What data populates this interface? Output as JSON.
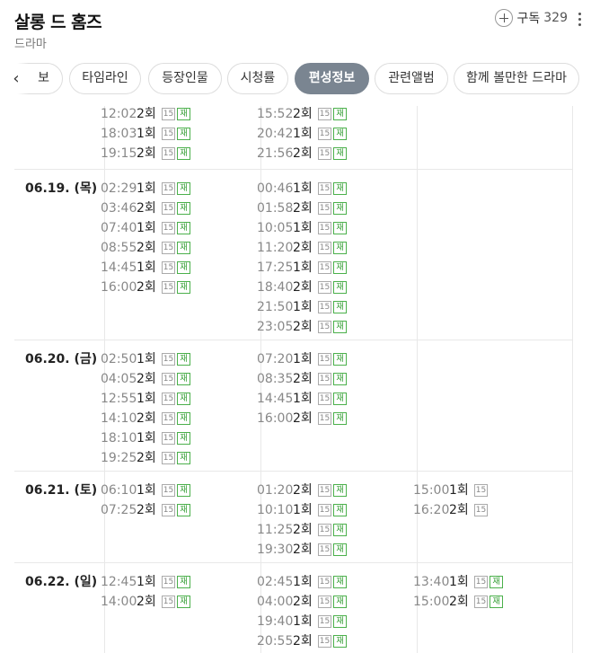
{
  "header": {
    "title": "살롱 드 홈즈",
    "genre": "드라마",
    "subscribe_label": "구독",
    "subscribe_count": "329"
  },
  "tabs": [
    {
      "label": "정보",
      "visible_label": "보"
    },
    {
      "label": "타임라인"
    },
    {
      "label": "등장인물"
    },
    {
      "label": "시청률"
    },
    {
      "label": "편성정보",
      "active": true
    },
    {
      "label": "관련앨범"
    },
    {
      "label": "함께 볼만한 드라마"
    }
  ],
  "badges": {
    "age": "15",
    "rerun": "재"
  },
  "schedule": [
    {
      "date": "",
      "columns": [
        [
          {
            "time": "12:02",
            "ep": "2회",
            "re": true
          },
          {
            "time": "18:03",
            "ep": "1회",
            "re": true
          },
          {
            "time": "19:15",
            "ep": "2회",
            "re": true
          }
        ],
        [
          {
            "time": "15:52",
            "ep": "2회",
            "re": true
          },
          {
            "time": "20:42",
            "ep": "1회",
            "re": true
          },
          {
            "time": "21:56",
            "ep": "2회",
            "re": true
          }
        ],
        []
      ]
    },
    {
      "date": "06.19. (목)",
      "columns": [
        [
          {
            "time": "02:29",
            "ep": "1회",
            "re": true
          },
          {
            "time": "03:46",
            "ep": "2회",
            "re": true
          },
          {
            "time": "07:40",
            "ep": "1회",
            "re": true
          },
          {
            "time": "08:55",
            "ep": "2회",
            "re": true
          },
          {
            "time": "14:45",
            "ep": "1회",
            "re": true
          },
          {
            "time": "16:00",
            "ep": "2회",
            "re": true
          }
        ],
        [
          {
            "time": "00:46",
            "ep": "1회",
            "re": true
          },
          {
            "time": "01:58",
            "ep": "2회",
            "re": true
          },
          {
            "time": "10:05",
            "ep": "1회",
            "re": true
          },
          {
            "time": "11:20",
            "ep": "2회",
            "re": true
          },
          {
            "time": "17:25",
            "ep": "1회",
            "re": true
          },
          {
            "time": "18:40",
            "ep": "2회",
            "re": true
          },
          {
            "time": "21:50",
            "ep": "1회",
            "re": true
          },
          {
            "time": "23:05",
            "ep": "2회",
            "re": true
          }
        ],
        []
      ]
    },
    {
      "date": "06.20. (금)",
      "columns": [
        [
          {
            "time": "02:50",
            "ep": "1회",
            "re": true
          },
          {
            "time": "04:05",
            "ep": "2회",
            "re": true
          },
          {
            "time": "12:55",
            "ep": "1회",
            "re": true
          },
          {
            "time": "14:10",
            "ep": "2회",
            "re": true
          },
          {
            "time": "18:10",
            "ep": "1회",
            "re": true
          },
          {
            "time": "19:25",
            "ep": "2회",
            "re": true
          }
        ],
        [
          {
            "time": "07:20",
            "ep": "1회",
            "re": true
          },
          {
            "time": "08:35",
            "ep": "2회",
            "re": true
          },
          {
            "time": "14:45",
            "ep": "1회",
            "re": true
          },
          {
            "time": "16:00",
            "ep": "2회",
            "re": true
          }
        ],
        []
      ]
    },
    {
      "date": "06.21. (토)",
      "columns": [
        [
          {
            "time": "06:10",
            "ep": "1회",
            "re": true
          },
          {
            "time": "07:25",
            "ep": "2회",
            "re": true
          }
        ],
        [
          {
            "time": "01:20",
            "ep": "2회",
            "re": true
          },
          {
            "time": "10:10",
            "ep": "1회",
            "re": true
          },
          {
            "time": "11:25",
            "ep": "2회",
            "re": true
          },
          {
            "time": "19:30",
            "ep": "2회",
            "re": true
          }
        ],
        [
          {
            "time": "15:00",
            "ep": "1회",
            "re": false
          },
          {
            "time": "16:20",
            "ep": "2회",
            "re": false
          }
        ]
      ]
    },
    {
      "date": "06.22. (일)",
      "columns": [
        [
          {
            "time": "12:45",
            "ep": "1회",
            "re": true
          },
          {
            "time": "14:00",
            "ep": "2회",
            "re": true
          }
        ],
        [
          {
            "time": "02:45",
            "ep": "1회",
            "re": true
          },
          {
            "time": "04:00",
            "ep": "2회",
            "re": true
          },
          {
            "time": "19:40",
            "ep": "1회",
            "re": true
          },
          {
            "time": "20:55",
            "ep": "2회",
            "re": true
          }
        ],
        [
          {
            "time": "13:40",
            "ep": "1회",
            "re": true
          },
          {
            "time": "15:00",
            "ep": "2회",
            "re": true
          }
        ]
      ]
    }
  ],
  "colors": {
    "active_tab": "#7a8591",
    "rerun_badge": "#2a9a2a",
    "border": "#e8e8e8"
  }
}
